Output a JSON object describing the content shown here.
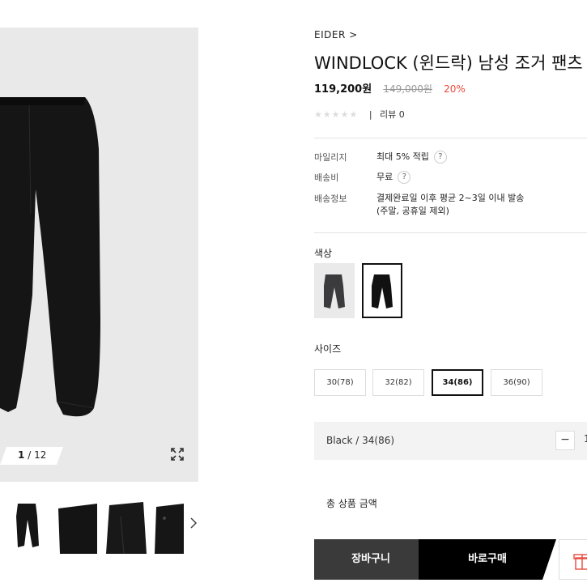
{
  "gallery": {
    "current": "1",
    "total": "12",
    "separator": "/",
    "zoom_icon": "expand-icon",
    "next_icon": "chevron-right-icon"
  },
  "product": {
    "brand": "EIDER",
    "brand_arrow": ">",
    "title": "WINDLOCK (윈드락) 남성 조거 팬츠",
    "price": "119,200원",
    "original_price": "149,000원",
    "discount": "20%",
    "review_label": "리뷰",
    "review_count": "0",
    "rating_stars": "★★★★★"
  },
  "info": [
    {
      "label": "마일리지",
      "value": "최대 5% 적립",
      "help": "?"
    },
    {
      "label": "배송비",
      "value": "무료",
      "help": "?"
    },
    {
      "label": "배송정보",
      "value": "결제완료일 이후 평균 2~3일 이내 발송",
      "value2": "(주말, 공휴일 제외)"
    }
  ],
  "options": {
    "color_label": "색상",
    "size_label": "사이즈",
    "sizes": [
      "30(78)",
      "32(82)",
      "34(86)",
      "36(90)"
    ],
    "selected_size": "34(86)"
  },
  "selection": {
    "label": "Black / 34(86)",
    "minus": "−",
    "quantity": "1"
  },
  "total": {
    "label": "총 상품 금액"
  },
  "actions": {
    "cart": "장바구니",
    "buy": "바로구매",
    "gift_icon": "gift-icon"
  },
  "colors": {
    "accent_discount": "#e84a3c",
    "buy_button": "#000000",
    "cart_button": "#3a3a3a"
  }
}
